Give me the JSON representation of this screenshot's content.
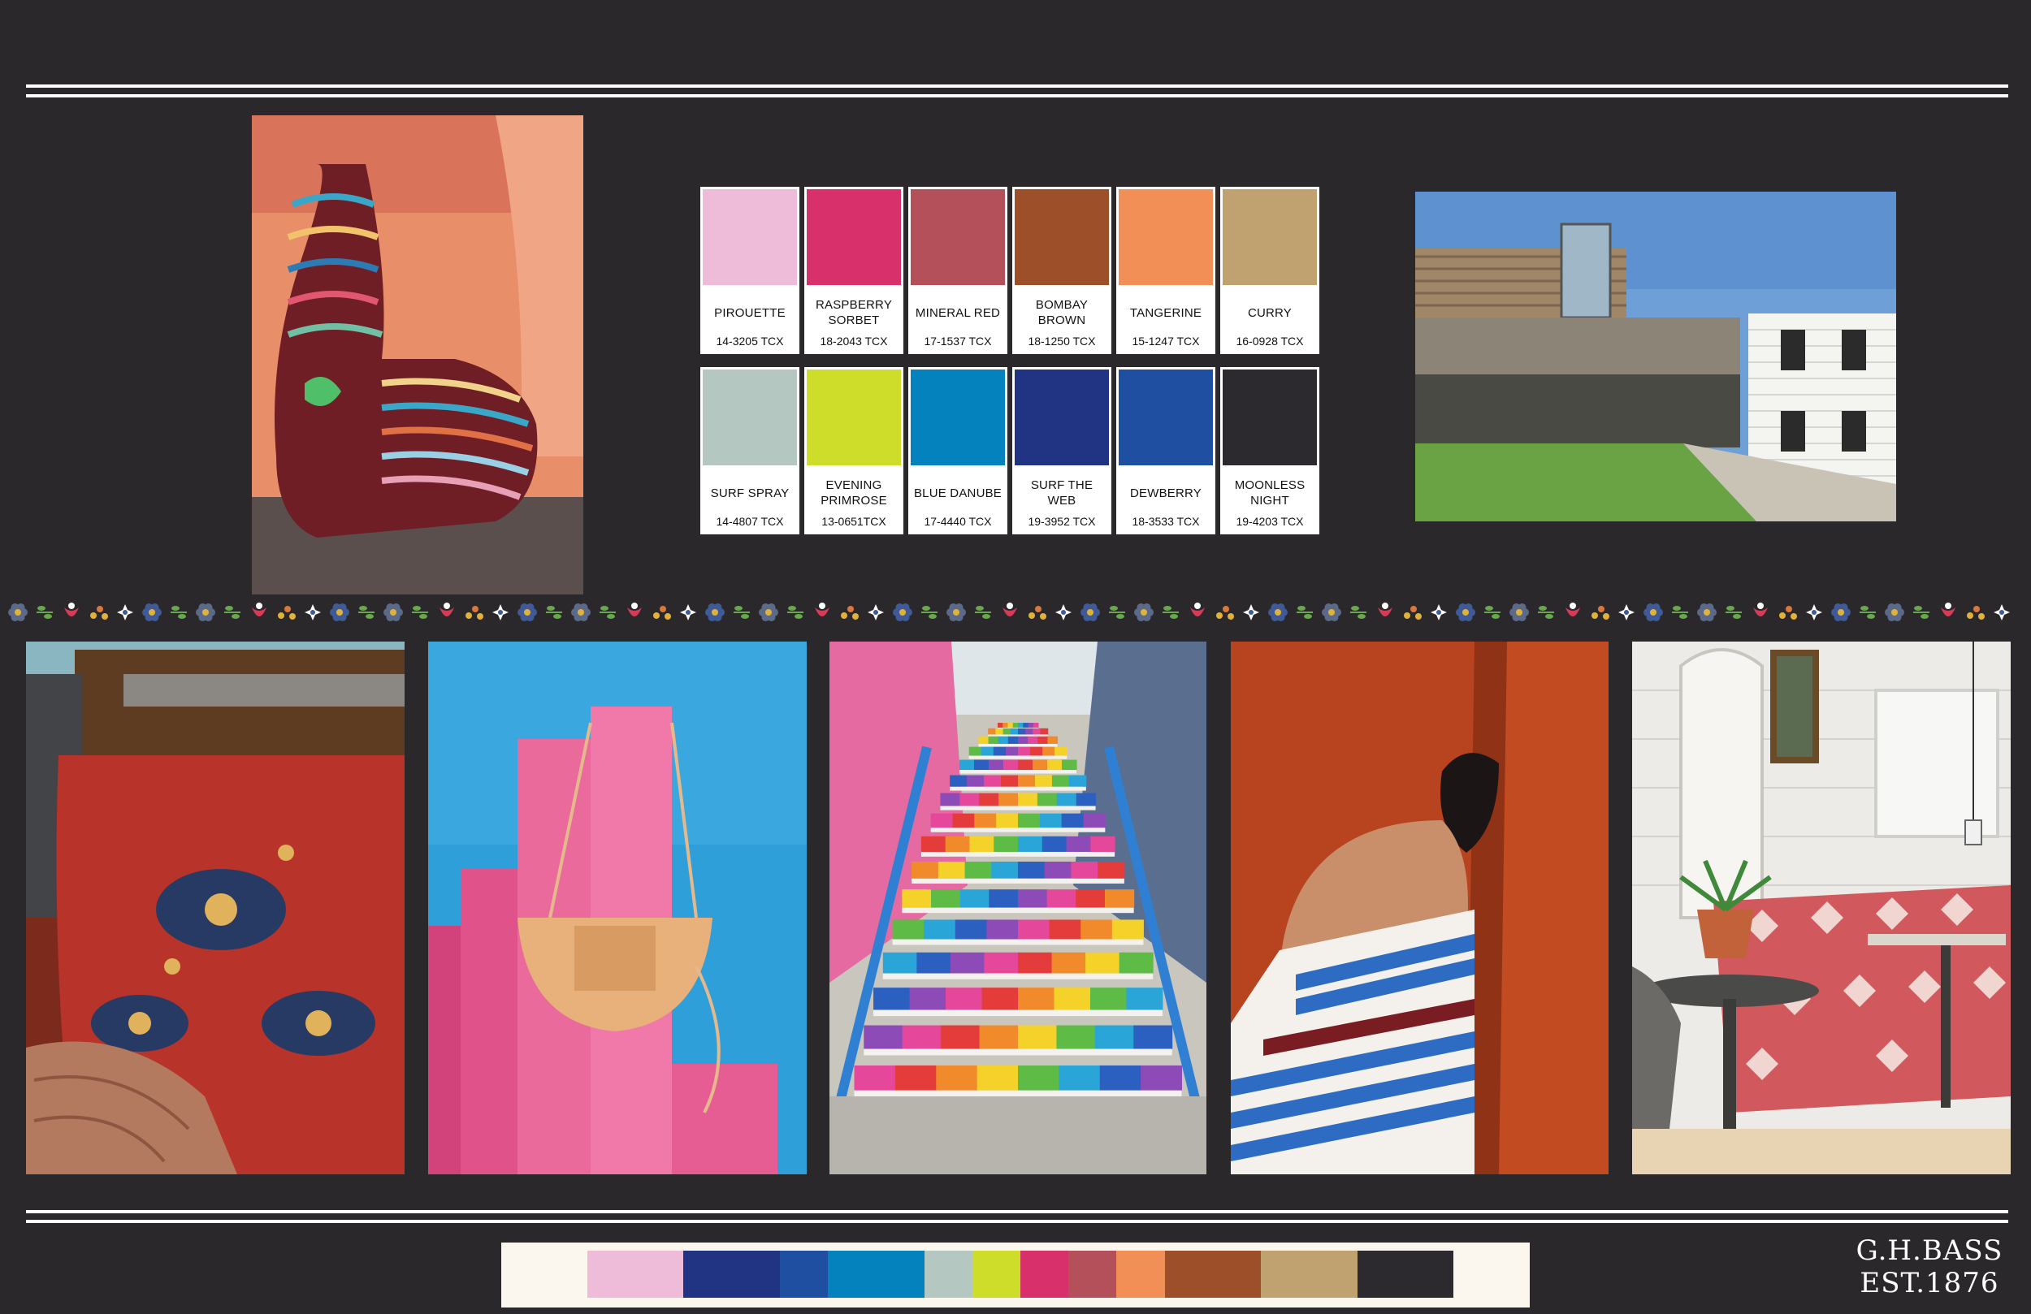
{
  "board": {
    "background": "#2a282b",
    "brand_line1": "G.H.BASS",
    "brand_line2": "EST.1876"
  },
  "swatches": [
    {
      "name": "PIROUETTE",
      "code": "14-3205 TCX",
      "color": "#eebcd9"
    },
    {
      "name": "RASPBERRY SORBET",
      "code": "18-2043 TCX",
      "color": "#d8306b"
    },
    {
      "name": "MINERAL RED",
      "code": "17-1537 TCX",
      "color": "#b4505a"
    },
    {
      "name": "BOMBAY BROWN",
      "code": "18-1250 TCX",
      "color": "#9c4f29"
    },
    {
      "name": "TANGERINE",
      "code": "15-1247 TCX",
      "color": "#f18f57"
    },
    {
      "name": "CURRY",
      "code": "16-0928 TCX",
      "color": "#c0a270"
    },
    {
      "name": "SURF SPRAY",
      "code": "14-4807 TCX",
      "color": "#b5c7c1"
    },
    {
      "name": "EVENING PRIMROSE",
      "code": "13-0651TCX",
      "color": "#cddd2a"
    },
    {
      "name": "BLUE DANUBE",
      "code": "17-4440 TCX",
      "color": "#0482bd"
    },
    {
      "name": "SURF THE WEB",
      "code": "19-3952 TCX",
      "color": "#213383"
    },
    {
      "name": "DEWBERRY",
      "code": "18-3533 TCX",
      "color": "#1f4fa0"
    },
    {
      "name": "MOONLESS NIGHT",
      "code": "19-4203 TCX",
      "color": "#2c2a2e"
    }
  ],
  "palette_bar": [
    {
      "color": "#eebcd9",
      "share": 1
    },
    {
      "color": "#213383",
      "share": 1
    },
    {
      "color": "#1f4fa0",
      "share": 0.5
    },
    {
      "color": "#0482bd",
      "share": 1
    },
    {
      "color": "#b5c7c1",
      "share": 0.5
    },
    {
      "color": "#cddd2a",
      "share": 0.5
    },
    {
      "color": "#d8306b",
      "share": 0.5
    },
    {
      "color": "#b4505a",
      "share": 0.5
    },
    {
      "color": "#f18f57",
      "share": 0.5
    },
    {
      "color": "#9c4f29",
      "share": 1
    },
    {
      "color": "#c0a270",
      "share": 1
    },
    {
      "color": "#2c2a2e",
      "share": 1
    }
  ],
  "photos": [
    {
      "subject": "clothing-chair"
    },
    {
      "subject": "modern-building"
    },
    {
      "subject": "car-interior-rug"
    },
    {
      "subject": "pink-pillars-handbag"
    },
    {
      "subject": "rainbow-stairs"
    },
    {
      "subject": "striped-dress-model"
    },
    {
      "subject": "ikat-cafe-booth"
    }
  ]
}
